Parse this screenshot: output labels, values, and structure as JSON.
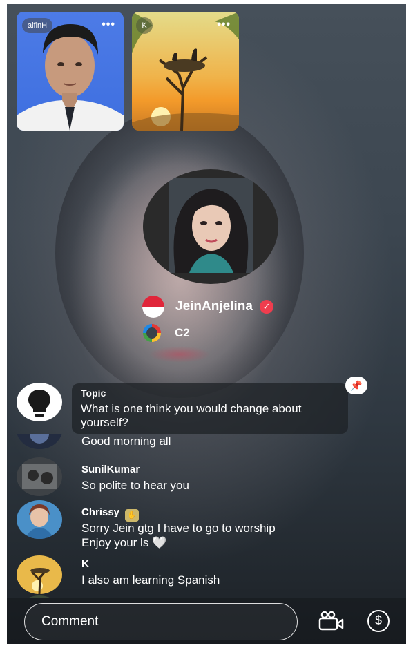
{
  "participants": [
    {
      "label": "alfinH",
      "more_icon": "more-dots-icon"
    },
    {
      "label": "K",
      "more_icon": "more-dots-icon"
    }
  ],
  "host": {
    "name": "JeinAnjelina",
    "flag": "indonesia-flag-icon",
    "verified": "verified-check-icon",
    "level": "C2"
  },
  "topic": {
    "title": "Topic",
    "text": "What is one think you would change about yourself?"
  },
  "chat": [
    {
      "name": "",
      "text": "Good morning all"
    },
    {
      "name": "SunilKumar",
      "text": "So polite to hear you"
    },
    {
      "name": "Chrissy",
      "text": "Sorry Jein gtg I have to go to worship",
      "text2": "Enjoy your ls 🤍"
    },
    {
      "name": "K",
      "text": "I also am learning Spanish"
    }
  ],
  "composer": {
    "placeholder": "Comment"
  },
  "colors": {
    "verified_red": "#ef3d4e",
    "accent_red": "#e53935"
  }
}
